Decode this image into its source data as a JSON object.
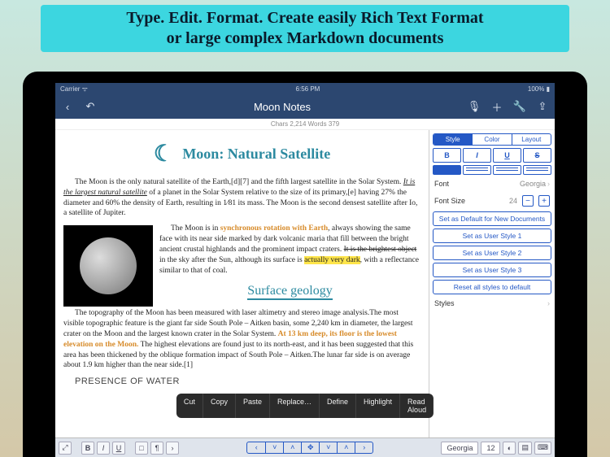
{
  "promo": {
    "line1": "Type. Edit. Format. Create easily Rich Text Format",
    "line2": "or large complex Markdown documents"
  },
  "statusbar": {
    "carrier": "Carrier ᯤ",
    "time": "6:56 PM",
    "battery": "100% ▮"
  },
  "navbar": {
    "title": "Moon Notes"
  },
  "counts": "Chars 2,214 Words 379",
  "doc": {
    "h1": "Moon: Natural Satellite",
    "p1a": "The Moon is the only natural satellite of the Earth,[d][7] and the fifth largest satellite in the Solar System. ",
    "p1b": "It is the largest natural satellite",
    "p1c": " of a planet in the Solar System relative to the size of its primary,[e] having 27% the diameter and 60% the density of Earth, resulting in 1⁄81 its mass. The Moon is the second densest satellite after Io, a satellite of Jupiter.",
    "p2a": "The Moon is in ",
    "p2b": "synchronous rotation with Earth",
    "p2c": ", always showing the same face with its near side marked by dark volcanic maria that fill between the bright ancient crustal highlands and the prominent impact craters. ",
    "p2d": "It is the brightest object",
    "p2e": " in the sky after the Sun, although its surface is ",
    "p2f": "actually very dark",
    "p2g": ", with a reflectance similar to that of coal.",
    "h2": "Surface geology",
    "p3a": "The topography of the Moon has been measured with laser altimetry and stereo image analysis.The most visible topographic feature is the giant far side South Pole – Aitken basin, some 2,240 km in diameter, the largest crater on the Moon and the largest known crater in the Solar System. ",
    "p3b": "At 13 km deep, its floor is the lowest elevation on the Moon.",
    "p3c": " The highest elevations are found just to its north-east, and it has been suggested that this area has been thickened by the oblique formation impact of South Pole – Aitken.The lunar far side is on average about 1.9 km higher than the near side.[1]",
    "presence": "PRESENCE OF WATER"
  },
  "context": [
    "Cut",
    "Copy",
    "Paste",
    "Replace…",
    "Define",
    "Highlight",
    "Read Aloud"
  ],
  "panel": {
    "tabs": [
      "Style",
      "Color",
      "Layout"
    ],
    "format": [
      "B",
      "I",
      "U",
      "S"
    ],
    "font_label": "Font",
    "font_value": "Georgia",
    "size_label": "Font Size",
    "size_value": "24",
    "btn_default": "Set as Default for New Documents",
    "btn_s1": "Set as User Style 1",
    "btn_s2": "Set as User Style 2",
    "btn_s3": "Set as User Style 3",
    "btn_reset": "Reset all styles to default",
    "styles_label": "Styles"
  },
  "toolbar": {
    "font": "Georgia",
    "size": "12"
  }
}
